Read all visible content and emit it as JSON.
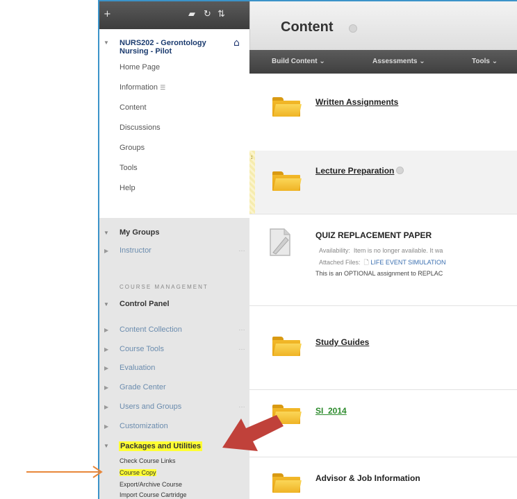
{
  "sidebar": {
    "course_title": "NURS202 - Gerontology Nursing - Pilot",
    "nav_items": [
      {
        "label": "Home Page"
      },
      {
        "label": "Information"
      },
      {
        "label": "Content"
      },
      {
        "label": "Discussions"
      },
      {
        "label": "Groups"
      },
      {
        "label": "Tools"
      },
      {
        "label": "Help"
      }
    ],
    "my_groups": {
      "title": "My Groups",
      "items": [
        {
          "label": "Instructor"
        }
      ]
    },
    "course_management_label": "COURSE MANAGEMENT",
    "control_panel": {
      "title": "Control Panel",
      "items": [
        {
          "label": "Content Collection"
        },
        {
          "label": "Course Tools"
        },
        {
          "label": "Evaluation"
        },
        {
          "label": "Grade Center"
        },
        {
          "label": "Users and Groups"
        },
        {
          "label": "Customization"
        }
      ]
    },
    "packages": {
      "title": "Packages and Utilities",
      "items": [
        {
          "label": "Check Course Links"
        },
        {
          "label": "Course Copy"
        },
        {
          "label": "Export/Archive Course"
        },
        {
          "label": "Import Course Cartridge"
        }
      ]
    }
  },
  "main": {
    "page_title": "Content",
    "action_bar": [
      {
        "label": "Build Content"
      },
      {
        "label": "Assessments"
      },
      {
        "label": "Tools"
      }
    ],
    "items": [
      {
        "title": "Written Assignments"
      },
      {
        "title": "Lecture Preparation"
      },
      {
        "title": "QUIZ REPLACEMENT PAPER",
        "availability_label": "Availability:",
        "availability_text": "Item is no longer available. It wa",
        "attached_label": "Attached Files:",
        "attached_file": "LIFE EVENT SIMULATION",
        "description": "This is an OPTIONAL assignment to REPLAC"
      },
      {
        "title": "Study Guides"
      },
      {
        "title": "SI_2014"
      },
      {
        "title": "Advisor & Job Information"
      }
    ]
  },
  "colors": {
    "frame_border": "#3b93c9",
    "highlight": "#ffff33",
    "red_arrow": "#c0413a",
    "orange_arrow": "#e8873a",
    "folder": "#f2b92a"
  }
}
